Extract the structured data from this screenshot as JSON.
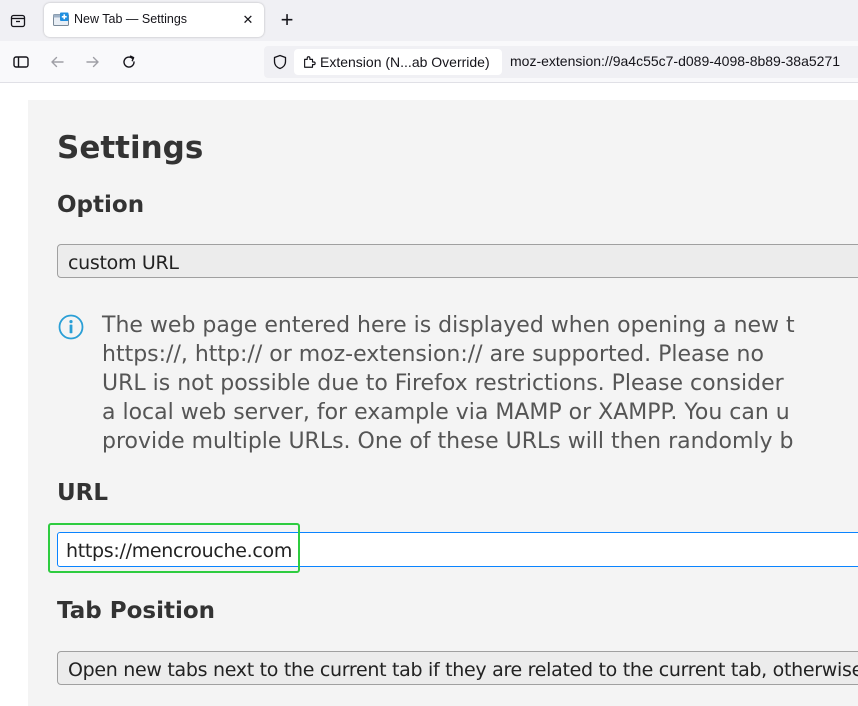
{
  "browser": {
    "tab": {
      "title": "New Tab — Settings",
      "favicon": "new-tab-settings-icon"
    },
    "new_tab_symbol": "+",
    "close_symbol": "✕",
    "urlbar": {
      "identity_label": "Extension (N...ab Override)",
      "url": "moz-extension://9a4c55c7-d089-4098-8b89-38a5271"
    }
  },
  "page": {
    "title": "Settings",
    "option_heading": "Option",
    "option_value": "custom URL",
    "info_lines": [
      "The web page entered here is displayed when opening a new t",
      "https://, http:// or moz-extension:// are supported. Please no",
      "URL is not possible due to Firefox restrictions. Please consider",
      "a local web server, for example via MAMP or XAMPP. You can u",
      "provide multiple URLs. One of these URLs will then randomly b"
    ],
    "url_heading": "URL",
    "url_value": "https://mencrouche.com",
    "tab_position_heading": "Tab Position",
    "tab_position_value": "Open new tabs next to the current tab if they are related to the current tab, otherwise at"
  },
  "colors": {
    "highlight": "#2ecc40",
    "focus": "#0a84ff",
    "info": "#2a9fd6"
  }
}
